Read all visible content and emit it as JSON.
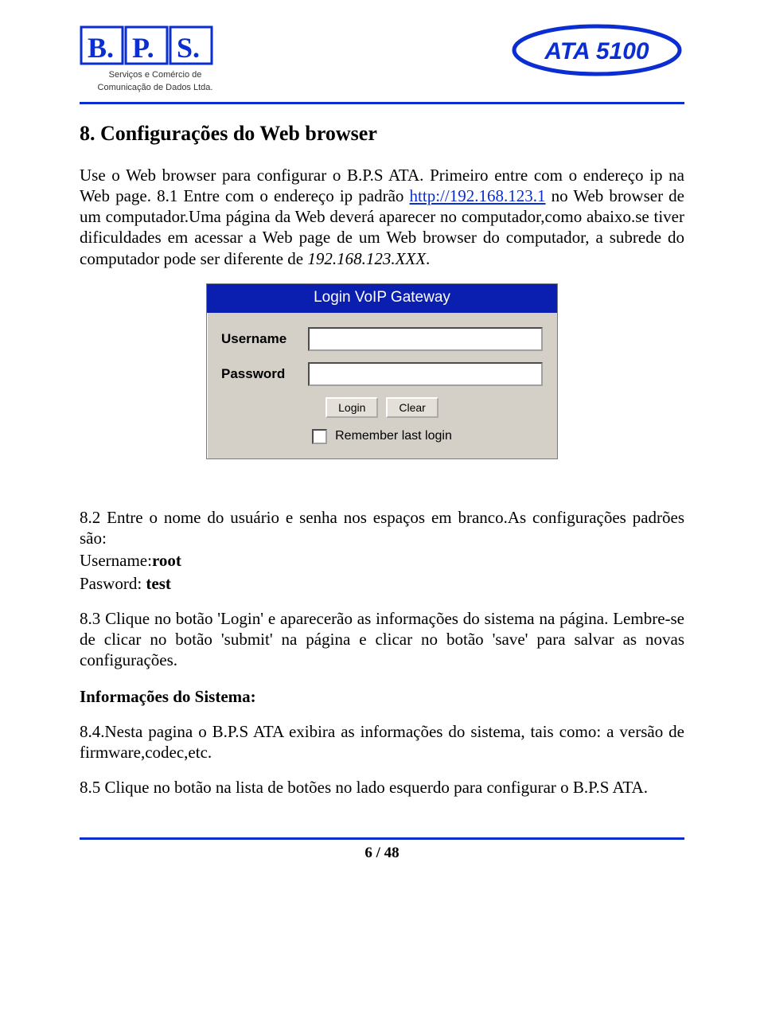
{
  "header": {
    "bps_letters": [
      "B.",
      "P.",
      "S."
    ],
    "bps_sub1": "Serviços e Comércio de",
    "bps_sub2": "Comunicação de Dados Ltda.",
    "ata_label": "ATA 5100"
  },
  "title": "8. Configurações do Web browser",
  "p1a": "Use o Web browser para configurar o B.P.S ATA. Primeiro entre com o endereço ip na Web page. 8.1 Entre com o endereço ip padrão ",
  "p1_link": "http://192.168.123.1",
  "p1b": " no Web browser de um computador.Uma página da Web deverá aparecer no computador,como abaixo.se tiver dificuldades em acessar a Web page de um Web browser do computador, a  subrede do computador  pode ser diferente de ",
  "p1_ital": "192.168.123.XXX",
  "p1c": ".",
  "login": {
    "title": "Login VoIP Gateway",
    "user_label": "Username",
    "pass_label": "Password",
    "login_btn": "Login",
    "clear_btn": "Clear",
    "remember": "Remember last login"
  },
  "p2": "8.2 Entre o nome do usuário e senha nos espaços em branco.As configurações padrões são:",
  "p2_user_label": "Username:",
  "p2_user_val": "root",
  "p2_pass_label": "Pasword: ",
  "p2_pass_val": "test",
  "p3": "8.3 Clique no botão 'Login' e aparecerão as informações do sistema na página. Lembre-se de clicar no botão 'submit' na página e clicar no botão 'save' para salvar as novas configurações.",
  "sub_title": "Informações do Sistema:",
  "p4": "8.4.Nesta pagina o B.P.S ATA exibira as informações do sistema, tais como: a versão de firmware,codec,etc.",
  "p5": "8.5 Clique no botão na lista de botões no lado esquerdo para configurar o B.P.S ATA.",
  "footer": "6 / 48"
}
